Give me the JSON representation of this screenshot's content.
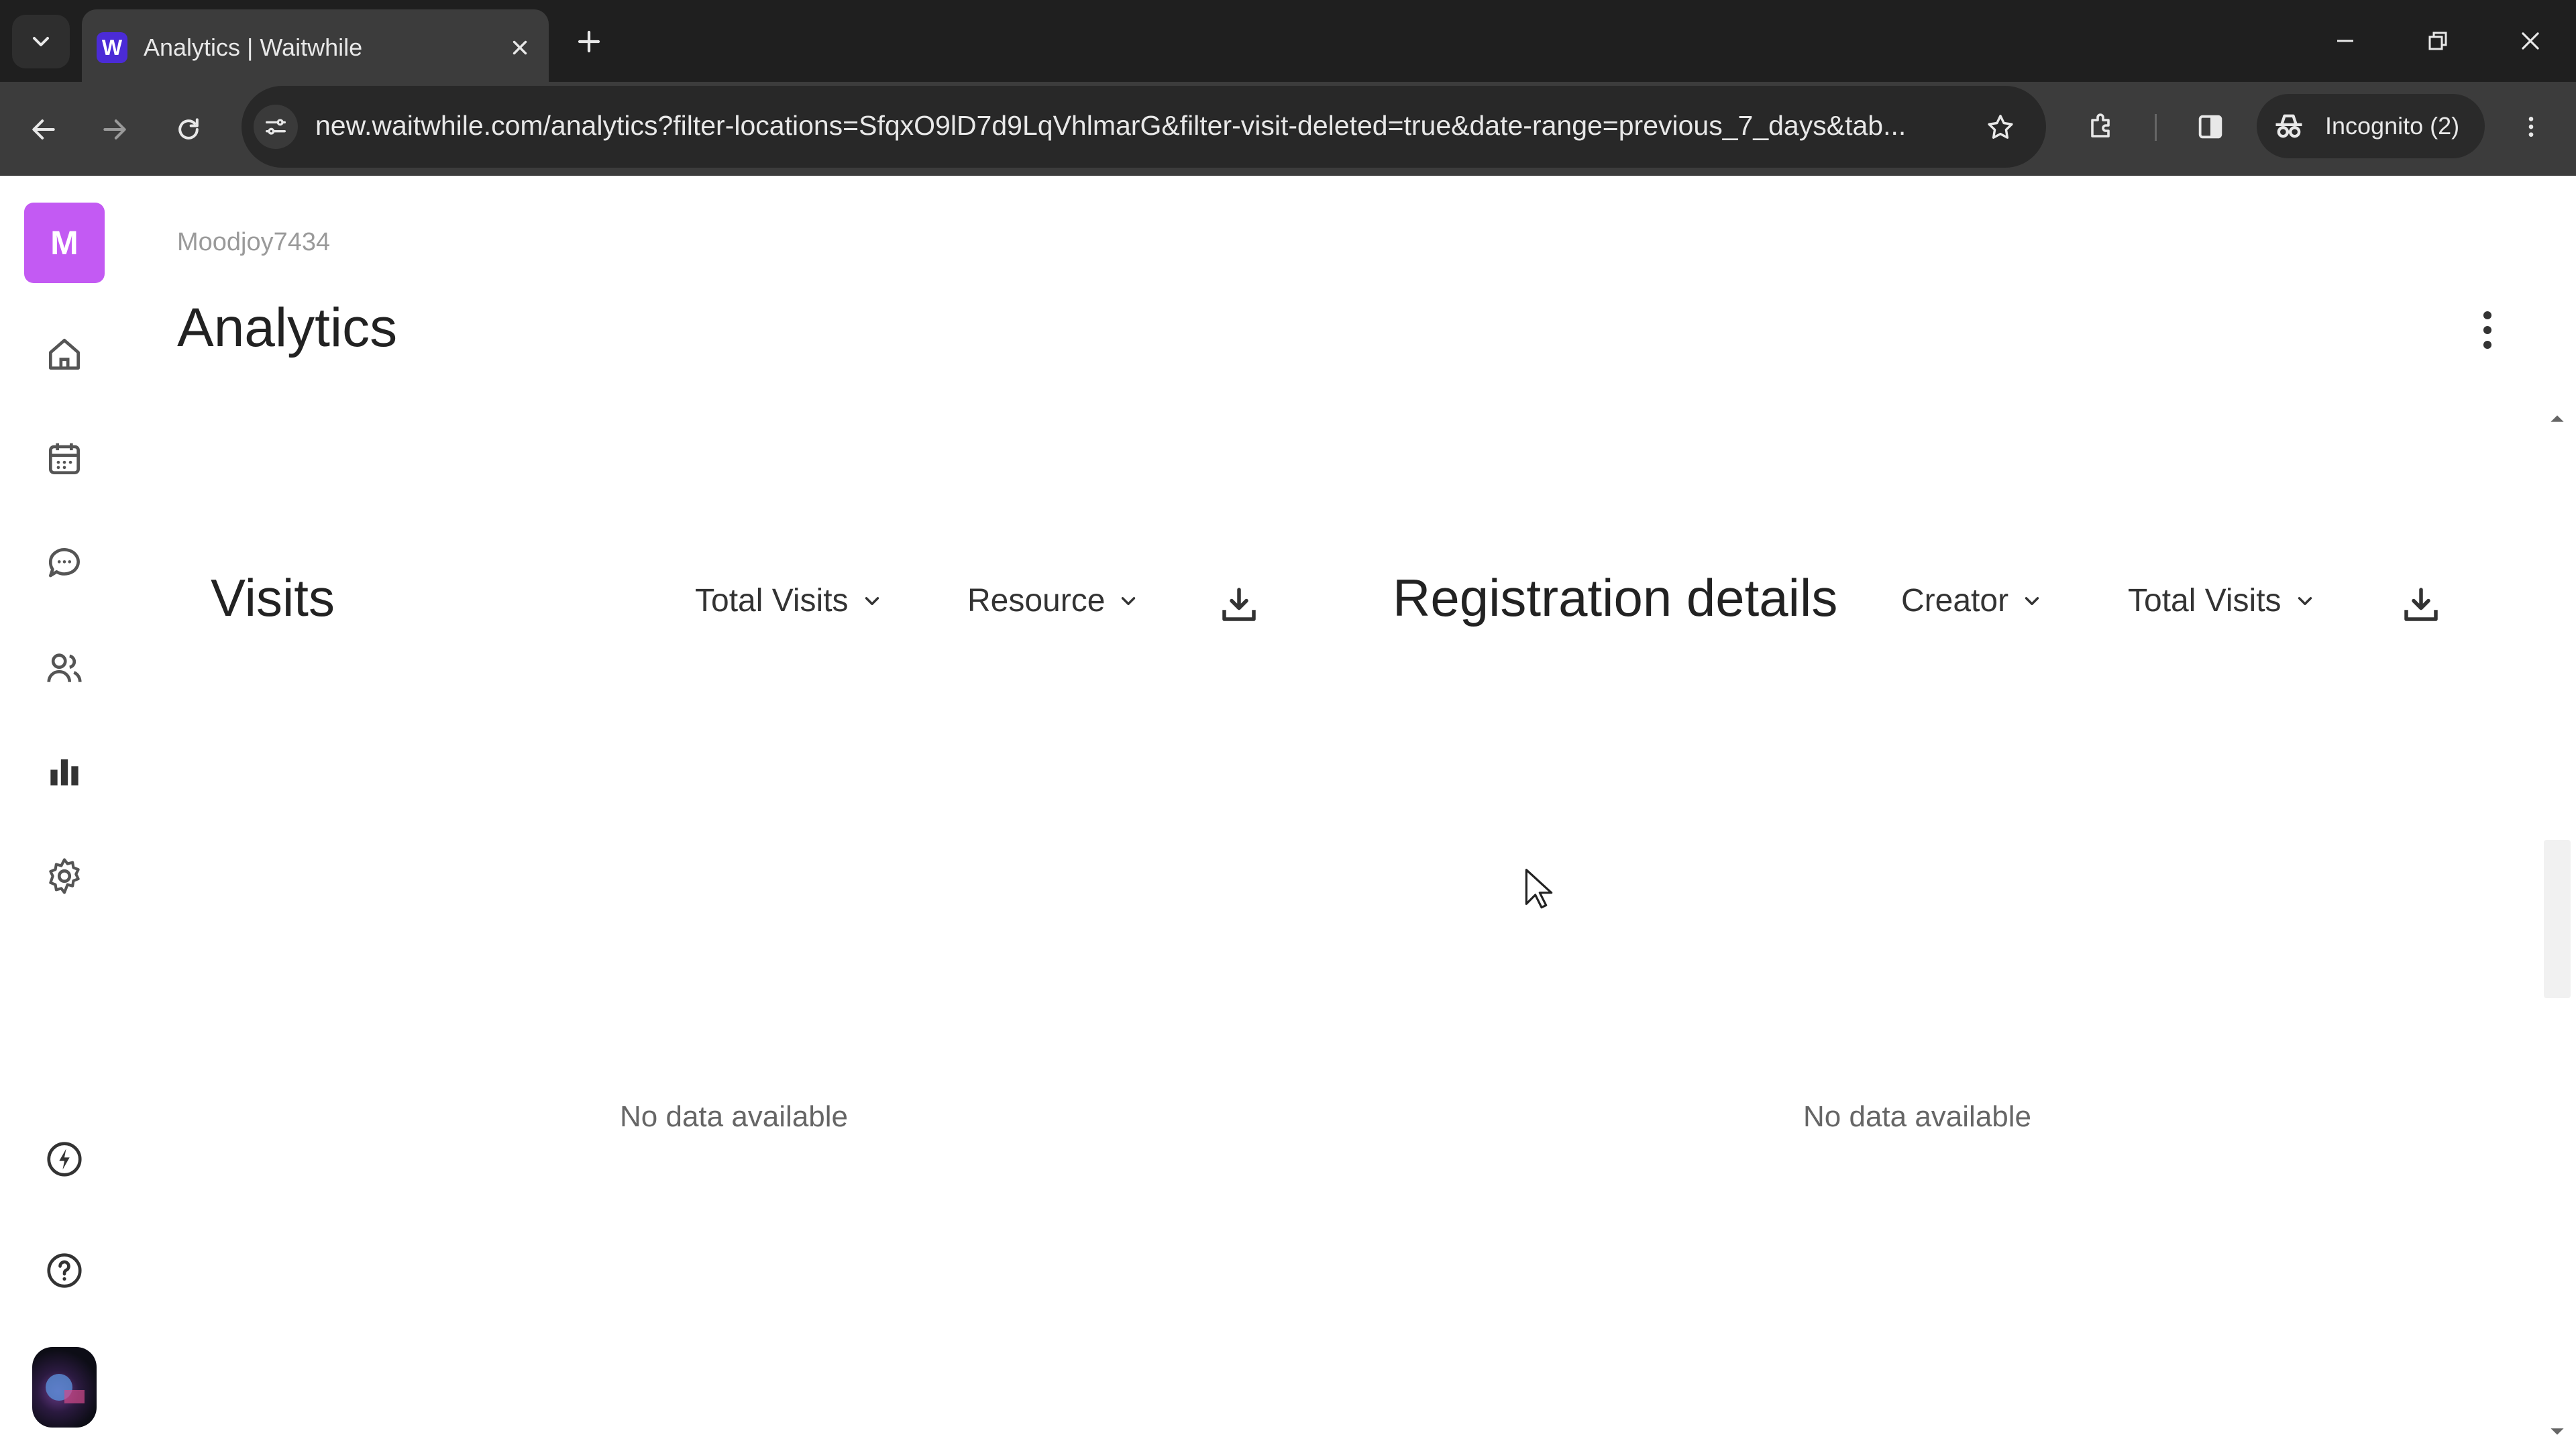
{
  "browser": {
    "tab_title": "Analytics | Waitwhile",
    "favicon_letter": "W",
    "url": "new.waitwhile.com/analytics?filter-locations=SfqxO9lD7d9LqVhlmarG&filter-visit-deleted=true&date-range=previous_7_days&tab...",
    "incognito_label": "Incognito (2)"
  },
  "sidebar": {
    "brand_letter": "M",
    "items": [
      {
        "icon": "home-icon"
      },
      {
        "icon": "calendar-icon"
      },
      {
        "icon": "chat-icon"
      },
      {
        "icon": "users-icon"
      },
      {
        "icon": "analytics-icon",
        "active": true
      },
      {
        "icon": "settings-icon"
      }
    ],
    "bottom": [
      {
        "icon": "lightning-icon"
      },
      {
        "icon": "help-icon"
      }
    ]
  },
  "header": {
    "workspace": "Moodjoy7434",
    "title": "Analytics"
  },
  "visits": {
    "title": "Visits",
    "metric_dropdown": "Total Visits",
    "group_dropdown": "Resource",
    "empty_text": "No data available"
  },
  "registration": {
    "title": "Registration details",
    "group_dropdown": "Creator",
    "metric_dropdown": "Total Visits",
    "empty_text": "No data available"
  },
  "colors": {
    "brand": "#c35af3",
    "favicon": "#4b2bd6",
    "chrome_dark": "#1f1f1f",
    "chrome_toolbar": "#3c3c3c"
  }
}
